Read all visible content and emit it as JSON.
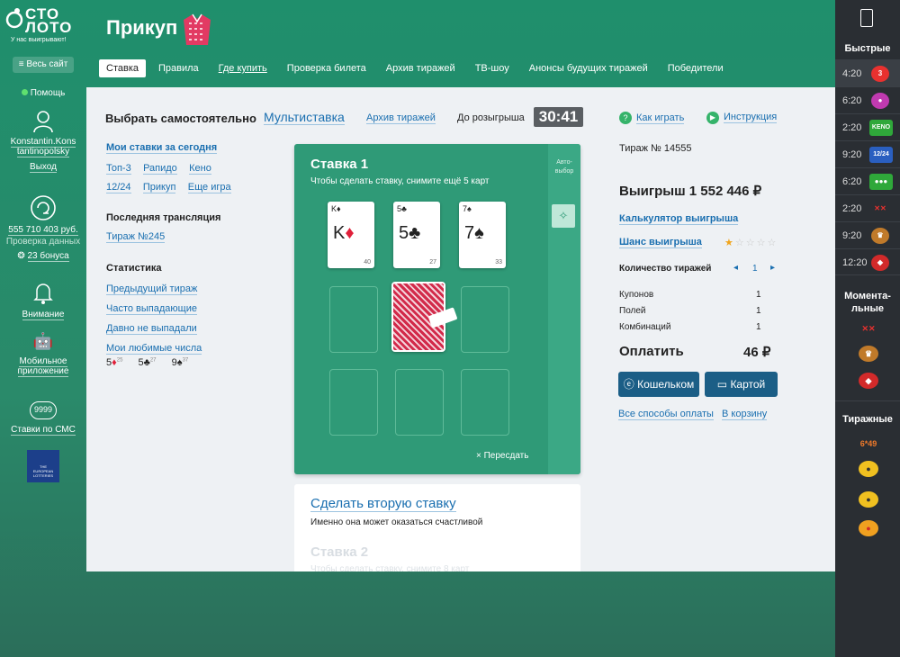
{
  "logo": {
    "line1": "СТО",
    "line2": "ЛОТО",
    "slogan": "У нас выигрывают!"
  },
  "left": {
    "all_site": "Весь сайт",
    "help": "Помощь",
    "user_name_1": "Konstantin.Kons",
    "user_name_2": "tantinopolsky",
    "logout": "Выход",
    "balance": "555 710 403 руб.",
    "check": "Проверка данных",
    "bonus": "23 бонуса",
    "attention": "Внимание",
    "mobile_1": "Мобильное",
    "mobile_2": "приложение",
    "sms_number": "9999",
    "sms": "Ставки по СМС",
    "el_1": "THE",
    "el_2": "EUROPEAN",
    "el_3": "LOTTERIES"
  },
  "header": {
    "game_title": "Прикуп"
  },
  "nav": [
    "Ставка",
    "Правила",
    "Где купить",
    "Проверка билета",
    "Архив тиражей",
    "ТВ-шоу",
    "Анонсы будущих тиражей",
    "Победители"
  ],
  "main": {
    "select_self": "Выбрать самостоятельно",
    "multi": "Мультиставка",
    "archive": "Архив тиражей",
    "until": "До розыгрыша",
    "timer": "30:41",
    "how_to": "Как играть",
    "instruction": "Инструкция",
    "my_bets": "Мои ставки за сегодня",
    "bet_links": [
      "Топ-3",
      "Рапидо",
      "Кено",
      "12/24",
      "Прикуп",
      "Еще игра"
    ],
    "last_broadcast": "Последняя трансляция",
    "draw_link": "Тираж №245",
    "stats": "Статистика",
    "stats_links": [
      "Предыдущий тираж",
      "Часто выпадающие",
      "Давно не выпадали",
      "Мои любимые числа"
    ],
    "fav": [
      {
        "num": "5",
        "suit": "♦",
        "sup": "25"
      },
      {
        "num": "5",
        "suit": "♣",
        "sup": "27"
      },
      {
        "num": "9",
        "suit": "♠",
        "sup": "37"
      }
    ]
  },
  "stake": {
    "title": "Ставка 1",
    "subtitle": "Чтобы сделать ставку, снимите ещё 5 карт",
    "auto_1": "Авто-",
    "auto_2": "выбор",
    "cards": [
      {
        "corner": "K♦",
        "big": "K",
        "suit": "♦",
        "num": "40"
      },
      {
        "corner": "5♣",
        "big": "5",
        "suit": "♣",
        "num": "27"
      },
      {
        "corner": "7♠",
        "big": "7",
        "suit": "♠",
        "num": "33"
      }
    ],
    "reshuffle": "× Пересдать"
  },
  "stake2": {
    "make_second": "Сделать вторую ставку",
    "lucky": "Именно она может оказаться счастливой",
    "title": "Ставка 2",
    "subtitle": "Чтобы сделать ставку, снимите 8 карт"
  },
  "right": {
    "draw": "Тираж № 14555",
    "win": "Выигрыш 1 552 446 ₽",
    "calc": "Калькулятор выигрыша",
    "chance": "Шанс выигрыша",
    "chance_rating": 1,
    "draws_label": "Количество тиражей",
    "draws_value": "1",
    "coupons_label": "Купонов",
    "coupons": "1",
    "fields_label": "Полей",
    "fields": "1",
    "combos_label": "Комбинаций",
    "combos": "1",
    "pay_label": "Оплатить",
    "pay_value": "46 ₽",
    "wallet_btn": "Кошельком",
    "card_btn": "Картой",
    "all_methods": "Все способы оплаты",
    "to_cart": "В корзину"
  },
  "rsidebar": {
    "fast": "Быстрые",
    "rows": [
      {
        "time": "4:20",
        "badge": "3",
        "color": "#e8312f"
      },
      {
        "time": "6:20",
        "badge": "●",
        "color": "#c03ab0"
      },
      {
        "time": "2:20",
        "badge": "KENO",
        "color": "#2fa83a"
      },
      {
        "time": "9:20",
        "badge": "12/24",
        "color": "#2a5fc0"
      },
      {
        "time": "6:20",
        "badge": "●●●",
        "color": "#2fa83a"
      },
      {
        "time": "2:20",
        "badge": "✕✕",
        "color": "#3a86c0"
      },
      {
        "time": "9:20",
        "badge": "♛",
        "color": "#c07a2a"
      },
      {
        "time": "12:20",
        "badge": "◆",
        "color": "#d22a2a"
      }
    ],
    "moment_1": "Момента-",
    "moment_2": "льные",
    "draw_lotto": "Тиражные",
    "lotto_649": "6*49"
  }
}
